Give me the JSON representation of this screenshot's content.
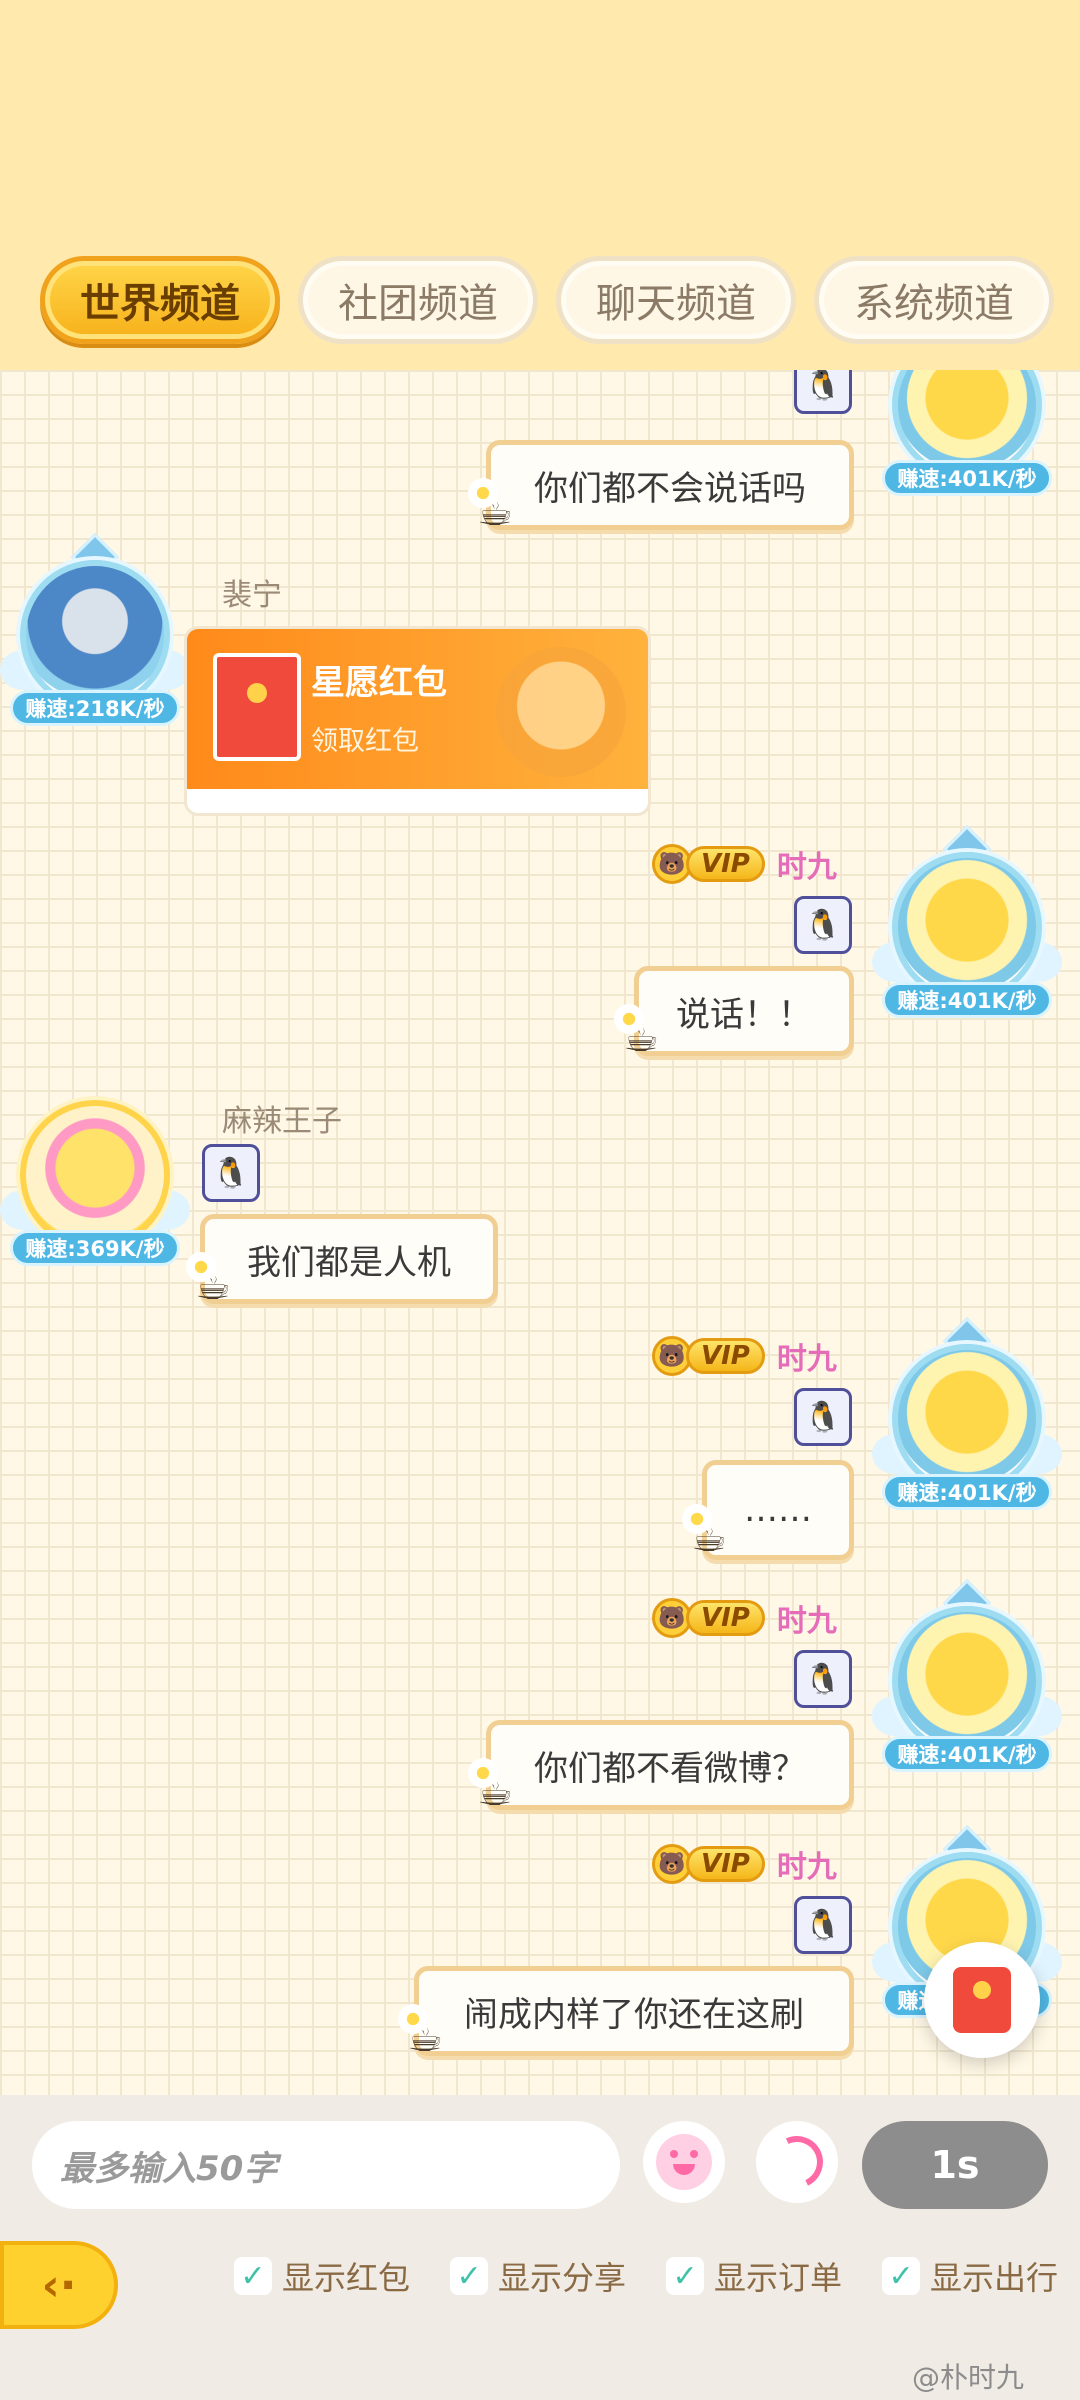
{
  "tabs": [
    {
      "label": "世界频道",
      "active": true
    },
    {
      "label": "社团频道",
      "active": false
    },
    {
      "label": "聊天频道",
      "active": false
    },
    {
      "label": "系统频道",
      "active": false
    }
  ],
  "messages": [
    {
      "side": "right",
      "speed": "赚速:401K/秒",
      "text": "你们都不会说话吗"
    },
    {
      "side": "left",
      "name": "裴宁",
      "speed": "赚速:218K/秒",
      "redpacket": {
        "title": "星愿红包",
        "subtitle": "领取红包"
      }
    },
    {
      "side": "right",
      "vip": "VIP",
      "name": "时九",
      "speed": "赚速:401K/秒",
      "text": "说话！！"
    },
    {
      "side": "left",
      "name": "麻辣王子",
      "speed": "赚速:369K/秒",
      "text": "我们都是人机"
    },
    {
      "side": "right",
      "vip": "VIP",
      "name": "时九",
      "speed": "赚速:401K/秒",
      "text": "……"
    },
    {
      "side": "right",
      "vip": "VIP",
      "name": "时九",
      "speed": "赚速:401K/秒",
      "text": "你们都不看微博？"
    },
    {
      "side": "right",
      "vip": "VIP",
      "name": "时九",
      "speed": "赚速:401K/秒",
      "text": "闹成内样了你还在这刷"
    }
  ],
  "input": {
    "placeholder": "最多输入50字",
    "send_label": "1s"
  },
  "filters": [
    {
      "label": "显示红包",
      "checked": true
    },
    {
      "label": "显示分享",
      "checked": true
    },
    {
      "label": "显示订单",
      "checked": true
    },
    {
      "label": "显示出行",
      "checked": true
    }
  ],
  "icons": {
    "check": "✓",
    "back": "‹·"
  },
  "watermark": "@朴时九",
  "colors": {
    "accent": "#f7b11a",
    "vip_name": "#e56cb8",
    "speed_badge": "#4fb7e4"
  }
}
